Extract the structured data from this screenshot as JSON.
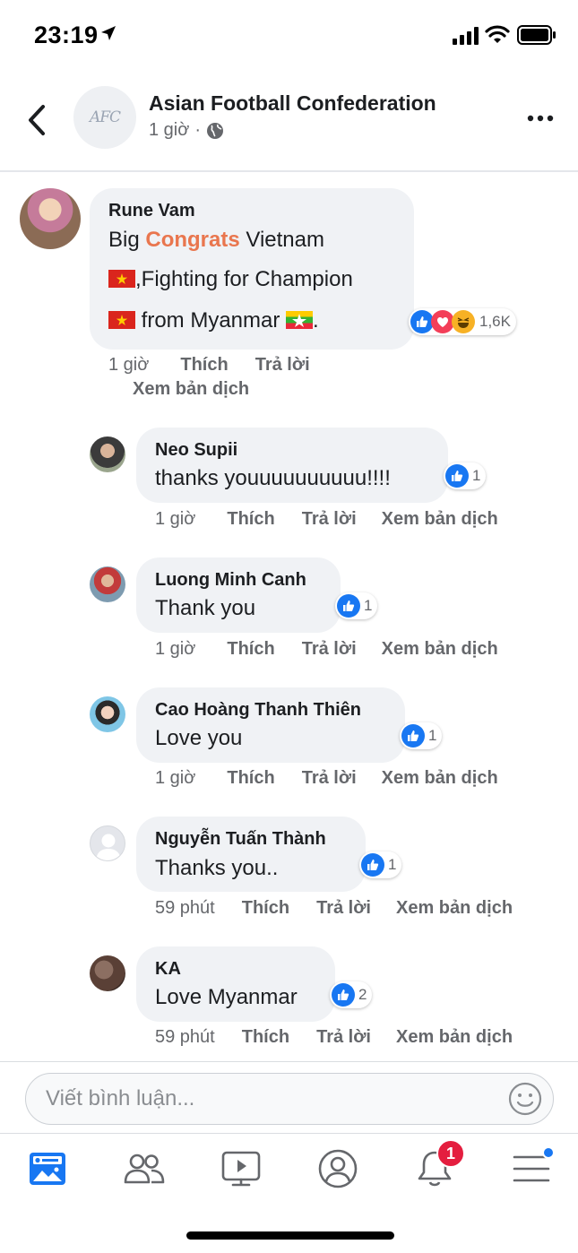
{
  "status_bar": {
    "time": "23:19"
  },
  "header": {
    "page_name": "Asian Football Confederation",
    "time": "1 giờ",
    "separator": "·",
    "avatar_text": "AFC"
  },
  "comments": [
    {
      "author": "Rune Vam",
      "line1_a": "Big ",
      "line1_b": "Congrats",
      "line1_c": "  Vietnam",
      "line2": ",Fighting for Champion",
      "line3": " from Myanmar ",
      "line3_end": ".",
      "reaction_count": "1,6K",
      "time": "1 giờ",
      "like": "Thích",
      "reply": "Trả lời",
      "translate": "Xem bản dịch"
    },
    {
      "author": "Neo Supii",
      "text": "thanks youuuuuuuuuu!!!!",
      "reaction_count": "1",
      "time": "1 giờ",
      "like": "Thích",
      "reply": "Trả lời",
      "translate": "Xem bản dịch"
    },
    {
      "author": "Luong Minh Canh",
      "text": "Thank you",
      "reaction_count": "1",
      "time": "1 giờ",
      "like": "Thích",
      "reply": "Trả lời",
      "translate": "Xem bản dịch"
    },
    {
      "author": "Cao Hoàng Thanh Thiên",
      "text": "Love you",
      "reaction_count": "1",
      "time": "1 giờ",
      "like": "Thích",
      "reply": "Trả lời",
      "translate": "Xem bản dịch"
    },
    {
      "author": "Nguyễn Tuấn Thành",
      "text": "Thanks you..",
      "reaction_count": "1",
      "time": "59 phút",
      "like": "Thích",
      "reply": "Trả lời",
      "translate": "Xem bản dịch"
    },
    {
      "author": "KA",
      "text": "Love Myanmar",
      "reaction_count": "2",
      "time": "59 phút",
      "like": "Thích",
      "reply": "Trả lời",
      "translate": "Xem bản dịch"
    }
  ],
  "composer": {
    "placeholder": "Viết bình luận..."
  },
  "tabbar": {
    "notification_count": "1"
  },
  "colors": {
    "accent": "#1877f2",
    "highlight": "#e9764e",
    "badge": "#e41e3f",
    "bubble": "#f0f2f5"
  },
  "icons": [
    "location-arrow-icon",
    "signal-icon",
    "wifi-icon",
    "battery-icon",
    "back-chevron-icon",
    "globe-icon",
    "more-icon",
    "like-icon",
    "love-icon",
    "haha-icon",
    "vietnam-flag-icon",
    "myanmar-flag-icon",
    "emoji-icon",
    "news-feed-icon",
    "friends-icon",
    "watch-icon",
    "profile-icon",
    "bell-icon",
    "menu-icon"
  ]
}
